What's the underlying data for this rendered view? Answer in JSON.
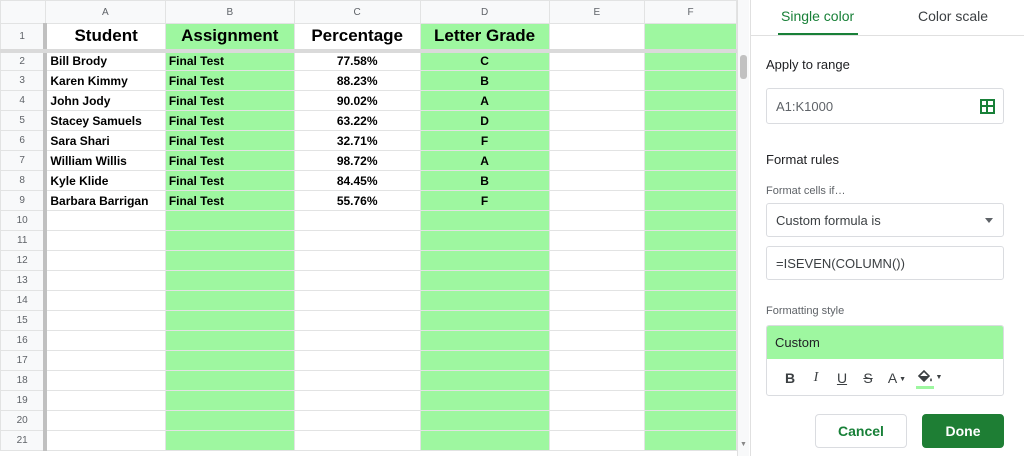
{
  "sheet": {
    "columns": [
      "A",
      "B",
      "C",
      "D",
      "E",
      "F"
    ],
    "header_row": {
      "row_number": "1",
      "cells": [
        "Student",
        "Assignment",
        "Percentage",
        "Letter Grade",
        "",
        ""
      ]
    },
    "rows": [
      {
        "n": "2",
        "cells": [
          "Bill Brody",
          "Final Test",
          "77.58%",
          "C"
        ]
      },
      {
        "n": "3",
        "cells": [
          "Karen Kimmy",
          "Final Test",
          "88.23%",
          "B"
        ]
      },
      {
        "n": "4",
        "cells": [
          "John Jody",
          "Final Test",
          "90.02%",
          "A"
        ]
      },
      {
        "n": "5",
        "cells": [
          "Stacey Samuels",
          "Final Test",
          "63.22%",
          "D"
        ]
      },
      {
        "n": "6",
        "cells": [
          "Sara Shari",
          "Final Test",
          "32.71%",
          "F"
        ]
      },
      {
        "n": "7",
        "cells": [
          "William Willis",
          "Final Test",
          "98.72%",
          "A"
        ]
      },
      {
        "n": "8",
        "cells": [
          "Kyle Klide",
          "Final Test",
          "84.45%",
          "B"
        ]
      },
      {
        "n": "9",
        "cells": [
          "Barbara Barrigan",
          "Final Test",
          "55.76%",
          "F"
        ]
      }
    ],
    "empty_row_numbers": [
      "10",
      "11",
      "12",
      "13",
      "14",
      "15",
      "16",
      "17",
      "18",
      "19",
      "20",
      "21"
    ],
    "highlight_color": "#9ef7a0"
  },
  "panel": {
    "tabs": {
      "single_color": "Single color",
      "color_scale": "Color scale"
    },
    "apply_to_range_label": "Apply to range",
    "range_value": "A1:K1000",
    "format_rules_label": "Format rules",
    "format_cells_if_label": "Format cells if…",
    "condition_value": "Custom formula is",
    "formula_value": "=ISEVEN(COLUMN())",
    "formatting_style_label": "Formatting style",
    "style_preview_text": "Custom",
    "style_tools": {
      "bold": "B",
      "italic": "I",
      "underline": "U",
      "strikethrough": "S",
      "text_color": "A"
    },
    "cancel_label": "Cancel",
    "done_label": "Done",
    "accent_color": "#188038"
  }
}
